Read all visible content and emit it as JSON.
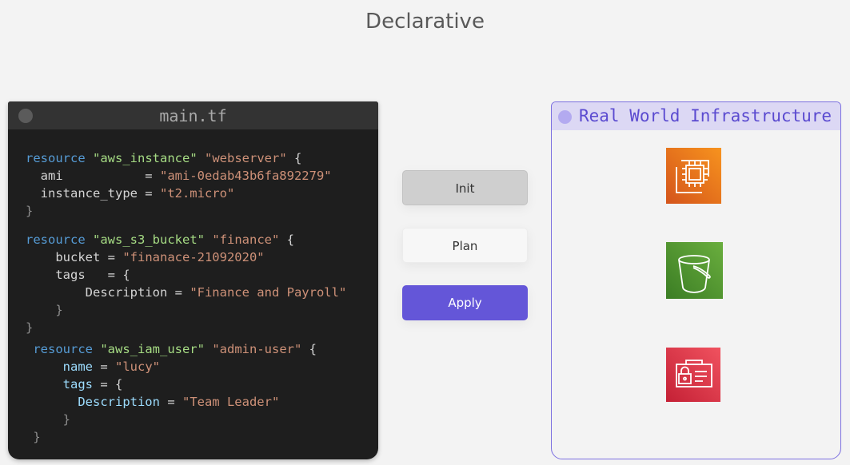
{
  "title": "Declarative",
  "editor": {
    "filename": "main.tf",
    "lines": [
      [
        {
          "c": "kw",
          "t": "resource "
        },
        {
          "c": "str1",
          "t": "\"aws_instance\""
        },
        {
          "c": "pl",
          "t": " "
        },
        {
          "c": "str",
          "t": "\"webserver\""
        },
        {
          "c": "pl",
          "t": " {"
        }
      ],
      [
        {
          "c": "pl",
          "t": "  ami           = "
        },
        {
          "c": "str",
          "t": "\"ami-0edab43b6fa892279\""
        }
      ],
      [
        {
          "c": "pl",
          "t": "  instance_type = "
        },
        {
          "c": "str",
          "t": "\"t2.micro\""
        }
      ],
      [
        {
          "c": "br",
          "t": "}"
        }
      ],
      [
        {
          "c": "kw",
          "t": "resource "
        },
        {
          "c": "str1",
          "t": "\"aws_s3_bucket\""
        },
        {
          "c": "pl",
          "t": " "
        },
        {
          "c": "str",
          "t": "\"finance\""
        },
        {
          "c": "pl",
          "t": " {"
        }
      ],
      [
        {
          "c": "pl",
          "t": "    bucket = "
        },
        {
          "c": "str",
          "t": "\"finanace-21092020\""
        }
      ],
      [
        {
          "c": "pl",
          "t": "    tags   = {"
        }
      ],
      [
        {
          "c": "pl",
          "t": "        Description = "
        },
        {
          "c": "str",
          "t": "\"Finance and Payroll\""
        }
      ],
      [
        {
          "c": "br",
          "t": "    }"
        }
      ],
      [
        {
          "c": "br",
          "t": "}"
        }
      ],
      [
        {
          "c": "kw",
          "t": " resource "
        },
        {
          "c": "str1",
          "t": "\"aws_iam_user\""
        },
        {
          "c": "pl",
          "t": " "
        },
        {
          "c": "str",
          "t": "\"admin-user\""
        },
        {
          "c": "pl",
          "t": " {"
        }
      ],
      [
        {
          "c": "id",
          "t": "     name"
        },
        {
          "c": "pl",
          "t": " = "
        },
        {
          "c": "str",
          "t": "\"lucy\""
        }
      ],
      [
        {
          "c": "id",
          "t": "     tags"
        },
        {
          "c": "pl",
          "t": " = {"
        }
      ],
      [
        {
          "c": "id",
          "t": "       Description"
        },
        {
          "c": "pl",
          "t": " = "
        },
        {
          "c": "str",
          "t": "\"Team Leader\""
        }
      ],
      [
        {
          "c": "br",
          "t": "     }"
        }
      ],
      [
        {
          "c": "br",
          "t": " }"
        }
      ]
    ]
  },
  "buttons": {
    "init": "Init",
    "plan": "Plan",
    "apply": "Apply"
  },
  "infra": {
    "title": "Real World Infrastructure",
    "services": [
      {
        "icon": "ec2-icon",
        "color_top": "#f7931e",
        "color_bottom": "#d4541b"
      },
      {
        "icon": "s3-bucket-icon",
        "color_top": "#6aae3e",
        "color_bottom": "#3b7d24"
      },
      {
        "icon": "iam-icon",
        "color_top": "#f0525f",
        "color_bottom": "#c42035"
      }
    ]
  }
}
